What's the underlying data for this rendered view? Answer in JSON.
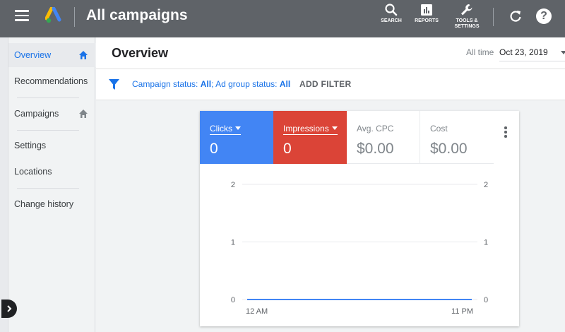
{
  "header": {
    "title": "All campaigns",
    "tools": [
      {
        "label": "SEARCH",
        "icon": "search-icon"
      },
      {
        "label": "REPORTS",
        "icon": "reports-icon"
      },
      {
        "label": "TOOLS &",
        "label2": "SETTINGS",
        "icon": "wrench-icon"
      }
    ],
    "help_label": "?"
  },
  "sidebar": {
    "items": [
      {
        "label": "Overview",
        "active": true
      },
      {
        "label": "Recommendations"
      },
      {
        "label": "Campaigns"
      },
      {
        "label": "Settings"
      },
      {
        "label": "Locations"
      },
      {
        "label": "Change history"
      }
    ]
  },
  "page": {
    "title": "Overview",
    "date_range_label": "All time",
    "date_value": "Oct 23, 2019"
  },
  "filters": {
    "campaign_status_prefix": "Campaign status: ",
    "campaign_status_value": "All",
    "separator": "; ",
    "adgroup_status_prefix": "Ad group status: ",
    "adgroup_status_value": "All",
    "add_filter": "ADD FILTER"
  },
  "metrics": [
    {
      "label": "Clicks",
      "value": "0",
      "color": "#4285f4"
    },
    {
      "label": "Impressions",
      "value": "0",
      "color": "#db4437"
    },
    {
      "label": "Avg. CPC",
      "value": "$0.00"
    },
    {
      "label": "Cost",
      "value": "$0.00"
    }
  ],
  "chart_data": {
    "type": "line",
    "x": [
      "12 AM",
      "11 PM"
    ],
    "series": [
      {
        "values": [
          0,
          0
        ],
        "color": "#db4437"
      },
      {
        "values": [
          0,
          0
        ],
        "color": "#4285f4"
      }
    ],
    "y_ticks_left": [
      0,
      1,
      2
    ],
    "y_ticks_right": [
      0,
      1,
      2
    ],
    "ylim": [
      0,
      2
    ],
    "grid": true
  },
  "colors": {
    "topbar": "#5f6368",
    "accent": "#1a73e8"
  }
}
